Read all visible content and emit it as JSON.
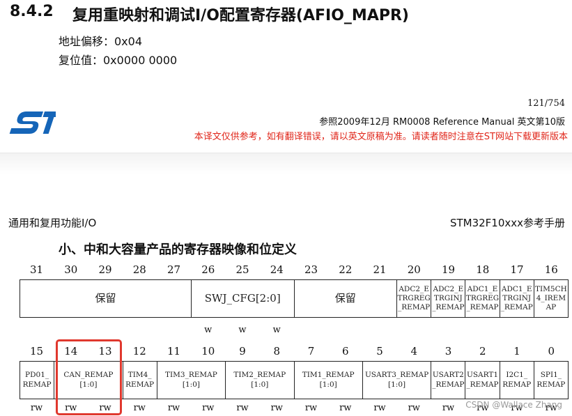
{
  "header": {
    "section_number": "8.4.2",
    "section_title": "复用重映射和调试I/O配置寄存器(AFIO_MAPR)",
    "address_offset": "地址偏移：0x04",
    "reset_value": "复位值：0x0000 0000"
  },
  "manual": {
    "page": "121/754",
    "reference": "参照2009年12月 RM0008 Reference Manual  英文第10版",
    "notice": "本译文仅供参考，如有翻译错误，请以英文原稿为准。请读者随时注意在ST网站下载更新版本",
    "logo_text": "ST",
    "brand_color": "#1565b8",
    "notice_color": "#e0261a"
  },
  "chapter": {
    "left": "通用和复用功能I/O",
    "right": "STM32F10xxx参考手册"
  },
  "table_heading": "小、中和大容量产品的寄存器映像和位定义",
  "register": {
    "upper_bits": [
      "31",
      "30",
      "29",
      "28",
      "27",
      "26",
      "25",
      "24",
      "23",
      "22",
      "21",
      "20",
      "19",
      "18",
      "17",
      "16"
    ],
    "upper_fields": [
      {
        "span": 5,
        "text": "保留",
        "style": "big"
      },
      {
        "span": 3,
        "text": "SWJ_CFG[2:0]",
        "style": "big"
      },
      {
        "span": 3,
        "text": "保留",
        "style": "big"
      },
      {
        "span": 1,
        "text": "ADC2_E TRGREG _REMAP",
        "style": "small"
      },
      {
        "span": 1,
        "text": "ADC2_E TRGINJ _REMAP",
        "style": "small"
      },
      {
        "span": 1,
        "text": "ADC1_E TRGREG _REMAP",
        "style": "small"
      },
      {
        "span": 1,
        "text": "ADC1_E TRGINJ _REMAP",
        "style": "small"
      },
      {
        "span": 1,
        "text": "TIM5CH 4_IREM AP",
        "style": "small"
      }
    ],
    "upper_access": [
      "",
      "",
      "",
      "",
      "",
      "w",
      "w",
      "w",
      "",
      "",
      "",
      "",
      "",
      "",
      "",
      ""
    ],
    "lower_bits": [
      "15",
      "14",
      "13",
      "12",
      "11",
      "10",
      "9",
      "8",
      "7",
      "6",
      "5",
      "4",
      "3",
      "2",
      "1",
      "0"
    ],
    "lower_fields": [
      {
        "span": 1,
        "text": "PD01_ REMAP",
        "style": "small"
      },
      {
        "span": 2,
        "text": "CAN_REMAP [1:0]",
        "style": "small",
        "highlight": true
      },
      {
        "span": 1,
        "text": "TIM4_ REMAP",
        "style": "small"
      },
      {
        "span": 2,
        "text": "TIM3_REMAP [1:0]",
        "style": "small"
      },
      {
        "span": 2,
        "text": "TIM2_REMAP [1:0]",
        "style": "small"
      },
      {
        "span": 2,
        "text": "TIM1_REMAP [1:0]",
        "style": "small"
      },
      {
        "span": 2,
        "text": "USART3_REMAP [1:0]",
        "style": "small"
      },
      {
        "span": 1,
        "text": "USART2 _REMAP",
        "style": "small"
      },
      {
        "span": 1,
        "text": "USART1 _REMAP",
        "style": "small"
      },
      {
        "span": 1,
        "text": "I2C1_ REMAP",
        "style": "small"
      },
      {
        "span": 1,
        "text": "SPI1_ REMAP",
        "style": "small"
      }
    ],
    "lower_access": [
      "rw",
      "rw",
      "rw",
      "rw",
      "rw",
      "rw",
      "rw",
      "rw",
      "rw",
      "rw",
      "rw",
      "rw",
      "rw",
      "rw",
      "rw",
      "rw"
    ]
  },
  "watermark": "CSDN @Wallace Zhang"
}
